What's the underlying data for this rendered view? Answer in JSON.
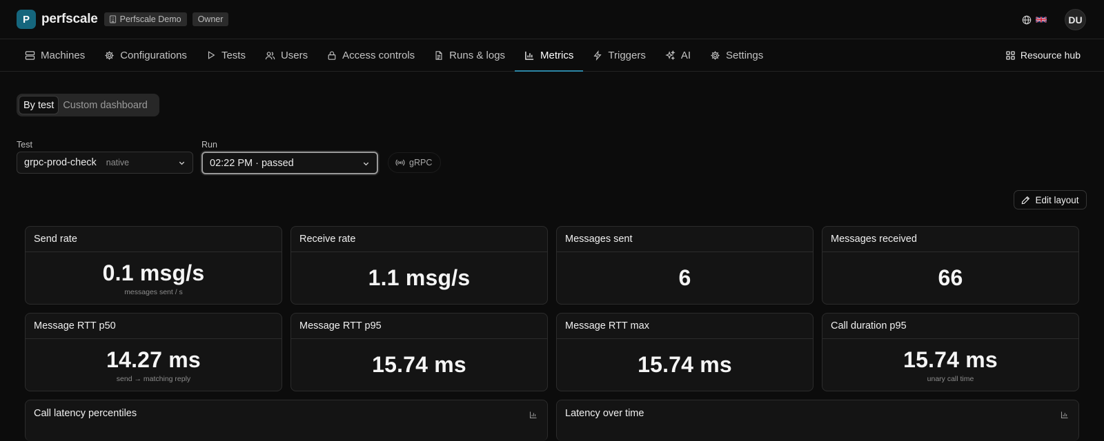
{
  "app": {
    "logo_letter": "P",
    "name": "perfscale",
    "org": "Perfscale Demo",
    "role": "Owner",
    "user_initials": "DU"
  },
  "icons": {
    "globe": "globe-icon",
    "flag": "uk-flag-icon"
  },
  "nav": {
    "items": [
      {
        "label": "Machines",
        "icon": "server-icon"
      },
      {
        "label": "Configurations",
        "icon": "gear-icon"
      },
      {
        "label": "Tests",
        "icon": "play-icon"
      },
      {
        "label": "Users",
        "icon": "users-icon"
      },
      {
        "label": "Access controls",
        "icon": "lock-icon"
      },
      {
        "label": "Runs & logs",
        "icon": "document-icon"
      },
      {
        "label": "Metrics",
        "icon": "bar-chart-icon",
        "active": true
      },
      {
        "label": "Triggers",
        "icon": "lightning-icon"
      },
      {
        "label": "AI",
        "icon": "sparkles-icon"
      },
      {
        "label": "Settings",
        "icon": "gear-icon"
      }
    ],
    "resource_hub": "Resource hub"
  },
  "view_toggle": {
    "options": [
      "By test",
      "Custom dashboard"
    ],
    "selected": "By test"
  },
  "filters": {
    "test_label": "Test",
    "test_value": "grpc-prod-check",
    "test_tag": "native",
    "run_label": "Run",
    "run_value": "02:22 PM · passed",
    "protocol": "gRPC"
  },
  "edit_layout": "Edit layout",
  "accent_color": "#2c86a6",
  "cards": [
    {
      "title": "Send rate",
      "value": "0.1 msg/s",
      "sub": "messages sent / s"
    },
    {
      "title": "Receive rate",
      "value": "1.1 msg/s",
      "sub": ""
    },
    {
      "title": "Messages sent",
      "value": "6",
      "sub": ""
    },
    {
      "title": "Messages received",
      "value": "66",
      "sub": ""
    },
    {
      "title": "Message RTT p50",
      "value": "14.27 ms",
      "sub": "send → matching reply"
    },
    {
      "title": "Message RTT p95",
      "value": "15.74 ms",
      "sub": ""
    },
    {
      "title": "Message RTT max",
      "value": "15.74 ms",
      "sub": ""
    },
    {
      "title": "Call duration p95",
      "value": "15.74 ms",
      "sub": "unary call time"
    }
  ],
  "charts": [
    {
      "title": "Call latency percentiles"
    },
    {
      "title": "Latency over time"
    }
  ]
}
